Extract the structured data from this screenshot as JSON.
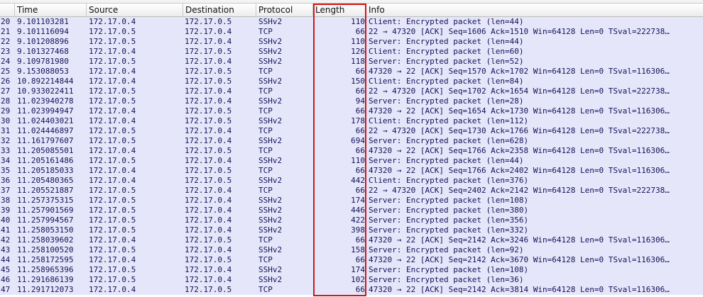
{
  "columns": {
    "no": "",
    "time": "Time",
    "source": "Source",
    "destination": "Destination",
    "protocol": "Protocol",
    "length": "Length",
    "info": "Info"
  },
  "highlight_color": "#d1161b",
  "row_color": "#e6e6fa",
  "packets": [
    {
      "no": "20",
      "time": "9.101103281",
      "src": "172.17.0.4",
      "dst": "172.17.0.5",
      "proto": "SSHv2",
      "len": "110",
      "info": "Client: Encrypted packet (len=44)"
    },
    {
      "no": "21",
      "time": "9.101116094",
      "src": "172.17.0.5",
      "dst": "172.17.0.4",
      "proto": "TCP",
      "len": "66",
      "info": "22 → 47320 [ACK] Seq=1606 Ack=1510 Win=64128 Len=0 TSval=222738…"
    },
    {
      "no": "22",
      "time": "9.101208896",
      "src": "172.17.0.5",
      "dst": "172.17.0.4",
      "proto": "SSHv2",
      "len": "110",
      "info": "Server: Encrypted packet (len=44)"
    },
    {
      "no": "23",
      "time": "9.101327468",
      "src": "172.17.0.4",
      "dst": "172.17.0.5",
      "proto": "SSHv2",
      "len": "126",
      "info": "Client: Encrypted packet (len=60)"
    },
    {
      "no": "24",
      "time": "9.109781980",
      "src": "172.17.0.5",
      "dst": "172.17.0.4",
      "proto": "SSHv2",
      "len": "118",
      "info": "Server: Encrypted packet (len=52)"
    },
    {
      "no": "25",
      "time": "9.153088053",
      "src": "172.17.0.4",
      "dst": "172.17.0.5",
      "proto": "TCP",
      "len": "66",
      "info": "47320 → 22 [ACK] Seq=1570 Ack=1702 Win=64128 Len=0 TSval=116306…"
    },
    {
      "no": "26",
      "time": "10.892214844",
      "src": "172.17.0.4",
      "dst": "172.17.0.5",
      "proto": "SSHv2",
      "len": "150",
      "info": "Client: Encrypted packet (len=84)"
    },
    {
      "no": "27",
      "time": "10.933022411",
      "src": "172.17.0.5",
      "dst": "172.17.0.4",
      "proto": "TCP",
      "len": "66",
      "info": "22 → 47320 [ACK] Seq=1702 Ack=1654 Win=64128 Len=0 TSval=222738…"
    },
    {
      "no": "28",
      "time": "11.023940278",
      "src": "172.17.0.5",
      "dst": "172.17.0.4",
      "proto": "SSHv2",
      "len": "94",
      "info": "Server: Encrypted packet (len=28)"
    },
    {
      "no": "29",
      "time": "11.023994947",
      "src": "172.17.0.4",
      "dst": "172.17.0.5",
      "proto": "TCP",
      "len": "66",
      "info": "47320 → 22 [ACK] Seq=1654 Ack=1730 Win=64128 Len=0 TSval=116306…"
    },
    {
      "no": "30",
      "time": "11.024403021",
      "src": "172.17.0.4",
      "dst": "172.17.0.5",
      "proto": "SSHv2",
      "len": "178",
      "info": "Client: Encrypted packet (len=112)"
    },
    {
      "no": "31",
      "time": "11.024446897",
      "src": "172.17.0.5",
      "dst": "172.17.0.4",
      "proto": "TCP",
      "len": "66",
      "info": "22 → 47320 [ACK] Seq=1730 Ack=1766 Win=64128 Len=0 TSval=222738…"
    },
    {
      "no": "32",
      "time": "11.161797607",
      "src": "172.17.0.5",
      "dst": "172.17.0.4",
      "proto": "SSHv2",
      "len": "694",
      "info": "Server: Encrypted packet (len=628)"
    },
    {
      "no": "33",
      "time": "11.205085501",
      "src": "172.17.0.4",
      "dst": "172.17.0.5",
      "proto": "TCP",
      "len": "66",
      "info": "47320 → 22 [ACK] Seq=1766 Ack=2358 Win=64128 Len=0 TSval=116306…"
    },
    {
      "no": "34",
      "time": "11.205161486",
      "src": "172.17.0.5",
      "dst": "172.17.0.4",
      "proto": "SSHv2",
      "len": "110",
      "info": "Server: Encrypted packet (len=44)"
    },
    {
      "no": "35",
      "time": "11.205185033",
      "src": "172.17.0.4",
      "dst": "172.17.0.5",
      "proto": "TCP",
      "len": "66",
      "info": "47320 → 22 [ACK] Seq=1766 Ack=2402 Win=64128 Len=0 TSval=116306…"
    },
    {
      "no": "36",
      "time": "11.205480365",
      "src": "172.17.0.4",
      "dst": "172.17.0.5",
      "proto": "SSHv2",
      "len": "442",
      "info": "Client: Encrypted packet (len=376)"
    },
    {
      "no": "37",
      "time": "11.205521887",
      "src": "172.17.0.5",
      "dst": "172.17.0.4",
      "proto": "TCP",
      "len": "66",
      "info": "22 → 47320 [ACK] Seq=2402 Ack=2142 Win=64128 Len=0 TSval=222738…"
    },
    {
      "no": "38",
      "time": "11.257375315",
      "src": "172.17.0.5",
      "dst": "172.17.0.4",
      "proto": "SSHv2",
      "len": "174",
      "info": "Server: Encrypted packet (len=108)"
    },
    {
      "no": "39",
      "time": "11.257901569",
      "src": "172.17.0.5",
      "dst": "172.17.0.4",
      "proto": "SSHv2",
      "len": "446",
      "info": "Server: Encrypted packet (len=380)"
    },
    {
      "no": "40",
      "time": "11.257994567",
      "src": "172.17.0.5",
      "dst": "172.17.0.4",
      "proto": "SSHv2",
      "len": "422",
      "info": "Server: Encrypted packet (len=356)"
    },
    {
      "no": "41",
      "time": "11.258053150",
      "src": "172.17.0.5",
      "dst": "172.17.0.4",
      "proto": "SSHv2",
      "len": "398",
      "info": "Server: Encrypted packet (len=332)"
    },
    {
      "no": "42",
      "time": "11.258039602",
      "src": "172.17.0.4",
      "dst": "172.17.0.5",
      "proto": "TCP",
      "len": "66",
      "info": "47320 → 22 [ACK] Seq=2142 Ack=3246 Win=64128 Len=0 TSval=116306…"
    },
    {
      "no": "43",
      "time": "11.258100520",
      "src": "172.17.0.5",
      "dst": "172.17.0.4",
      "proto": "SSHv2",
      "len": "158",
      "info": "Server: Encrypted packet (len=92)"
    },
    {
      "no": "44",
      "time": "11.258172595",
      "src": "172.17.0.4",
      "dst": "172.17.0.5",
      "proto": "TCP",
      "len": "66",
      "info": "47320 → 22 [ACK] Seq=2142 Ack=3670 Win=64128 Len=0 TSval=116306…"
    },
    {
      "no": "45",
      "time": "11.258965396",
      "src": "172.17.0.5",
      "dst": "172.17.0.4",
      "proto": "SSHv2",
      "len": "174",
      "info": "Server: Encrypted packet (len=108)"
    },
    {
      "no": "46",
      "time": "11.291686139",
      "src": "172.17.0.5",
      "dst": "172.17.0.4",
      "proto": "SSHv2",
      "len": "102",
      "info": "Server: Encrypted packet (len=36)"
    },
    {
      "no": "47",
      "time": "11.291712073",
      "src": "172.17.0.4",
      "dst": "172.17.0.5",
      "proto": "TCP",
      "len": "66",
      "info": "47320 → 22 [ACK] Seq=2142 Ack=3814 Win=64128 Len=0 TSval=116306…"
    }
  ]
}
